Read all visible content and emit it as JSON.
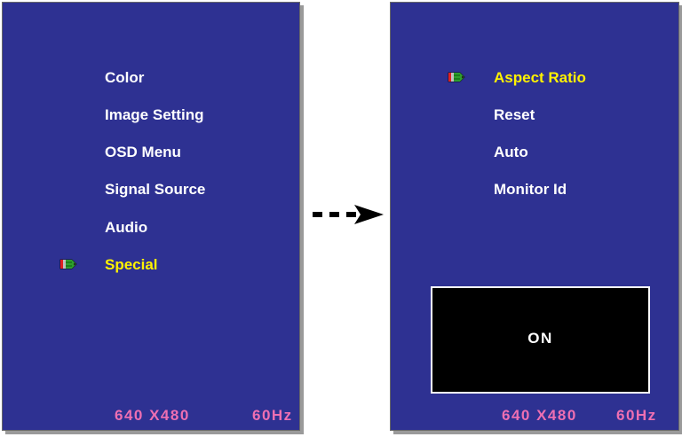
{
  "left_panel": {
    "menu": [
      {
        "label": "Color"
      },
      {
        "label": "Image Setting"
      },
      {
        "label": "OSD Menu"
      },
      {
        "label": "Signal Source"
      },
      {
        "label": "Audio"
      },
      {
        "label": "Special",
        "selected": true
      }
    ],
    "selector_icon": "pencil-icon",
    "status": {
      "resolution": "640 X480",
      "refresh": "60Hz"
    }
  },
  "transition_icon": "dashed-arrow-right-icon",
  "right_panel": {
    "menu": [
      {
        "label": "Aspect Ratio",
        "selected": true
      },
      {
        "label": "Reset"
      },
      {
        "label": "Auto"
      },
      {
        "label": "Monitor Id"
      }
    ],
    "selector_icon": "pencil-icon",
    "value_box": {
      "value": "ON"
    },
    "status": {
      "resolution": "640 X480",
      "refresh": "60Hz"
    }
  },
  "colors": {
    "panel_bg": "#2e3192",
    "text": "#ffffff",
    "selected_text": "#fff200",
    "status_text": "#ee6fb2",
    "value_box_bg": "#000000"
  }
}
